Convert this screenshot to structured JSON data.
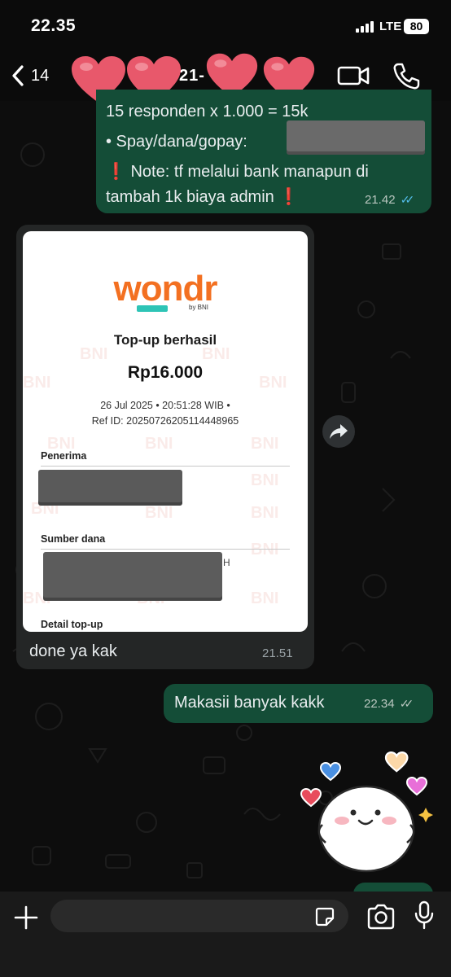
{
  "status_bar": {
    "time": "22.35",
    "network": "LTE",
    "battery": "80"
  },
  "header": {
    "back_count": "14",
    "contact_name": "21-      -",
    "video_icon": "video-camera-icon",
    "call_icon": "phone-icon"
  },
  "messages": {
    "top_outgoing": {
      "line1": "15 responden  x 1.000 = 15k",
      "line2": "• Spay/dana/gopay:",
      "line3": "❗ Note: tf melalui bank manapun di",
      "line4": "tambah 1k biaya admin ❗",
      "time": "21.42",
      "read": true
    },
    "incoming_image": {
      "receipt": {
        "logo": "wondr",
        "logo_by": "by BNI",
        "title": "Top-up berhasil",
        "amount": "Rp16.000",
        "datetime": "26 Jul 2025 • 20:51:28 WIB •",
        "ref": "Ref ID: 20250726205114448965",
        "label_recipient": "Penerima",
        "label_source": "Sumber dana",
        "source_trailing": "H",
        "label_detail": "Detail top-up",
        "watermark": "BNI"
      },
      "caption": "done ya kak",
      "time": "21.51"
    },
    "second_outgoing": {
      "text": "Makasii banyak kakk",
      "time": "22.34",
      "read": false
    }
  },
  "input_bar": {
    "message_value": "",
    "plus_icon": "plus-icon",
    "sticker_icon": "sticker-icon",
    "camera_icon": "camera-icon",
    "mic_icon": "microphone-icon"
  },
  "colors": {
    "outgoing_bubble": "#144d37",
    "incoming_bubble": "#242626",
    "brand_orange": "#f37021",
    "brand_teal": "#2ec4b6",
    "read_ticks": "#53bdeb",
    "heart": "#e8586b"
  }
}
